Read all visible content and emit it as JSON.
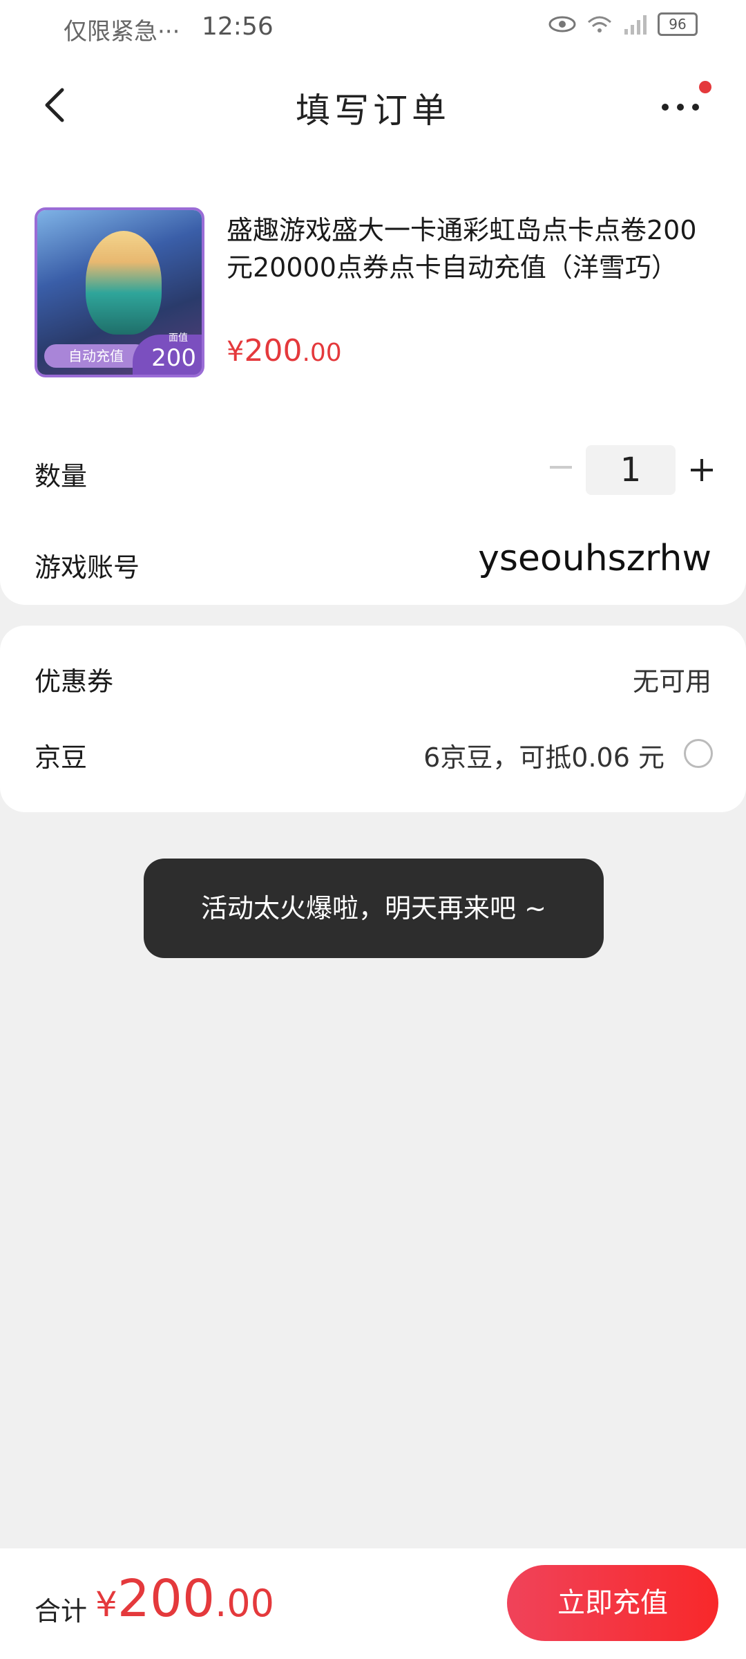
{
  "status_bar": {
    "left_text": "仅限紧急···",
    "time": "12:56",
    "battery": "96"
  },
  "header": {
    "title": "填写订单"
  },
  "product": {
    "name": "盛趣游戏盛大一卡通彩虹岛点卡点卷200元20000点券点卡自动充值（洋雪巧）",
    "price_currency": "¥",
    "price_int": "200",
    "price_dec": ".00",
    "thumb_ribbon": "自动充值",
    "thumb_value_label": "面值",
    "thumb_value": "200"
  },
  "quantity": {
    "label": "数量",
    "value": "1"
  },
  "account": {
    "label": "游戏账号",
    "value": "yseouhszrhw"
  },
  "coupon": {
    "label": "优惠券",
    "value": "无可用"
  },
  "jingdou": {
    "label": "京豆",
    "value": "6京豆，可抵0.06 元"
  },
  "toast": {
    "message": "活动太火爆啦，明天再来吧 ~"
  },
  "footer": {
    "total_label": "合计",
    "total_currency": "¥",
    "total_int": "200",
    "total_dec": ".00",
    "submit_label": "立即充值"
  },
  "colors": {
    "accent": "#e4393c",
    "toast_bg": "#2d2d2d",
    "page_bg": "#f0f0f0"
  }
}
